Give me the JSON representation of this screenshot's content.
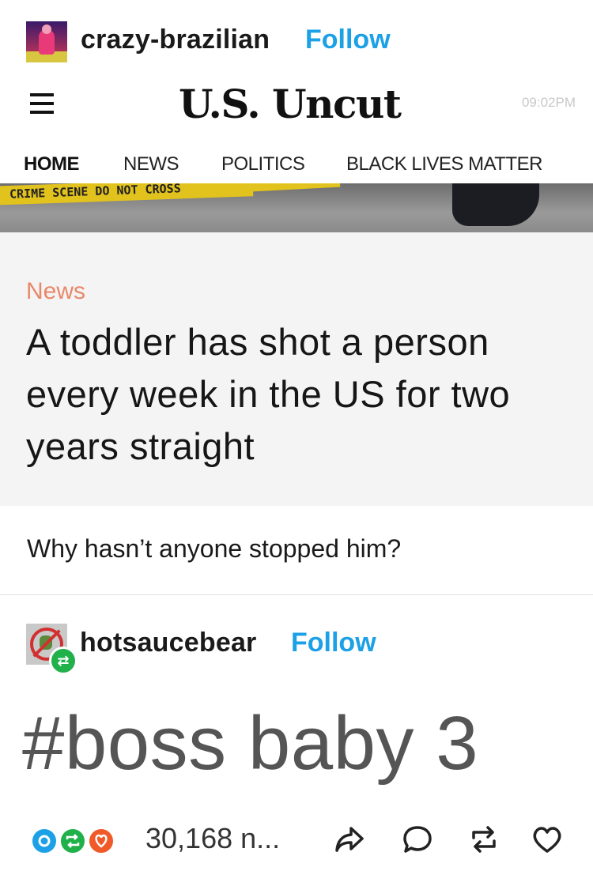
{
  "post": {
    "username": "crazy-brazilian",
    "follow_label": "Follow"
  },
  "article": {
    "site_name": "U.S. Uncut",
    "time": "09:02PM",
    "nav": [
      "HOME",
      "NEWS",
      "POLITICS",
      "BLACK LIVES MATTER"
    ],
    "tape_text": "CRIME SCENE DO NOT CROSS",
    "category": "News",
    "title": "A toddler has shot a person every week in the US for two years straight"
  },
  "caption": "Why hasn’t anyone stopped him?",
  "reblog": {
    "username": "hotsaucebear",
    "follow_label": "Follow"
  },
  "tag": "#boss baby 3",
  "footer": {
    "notes": "30,168 n...",
    "bubble_colors": [
      "#1ca0e6",
      "#20b14a",
      "#f05a28"
    ]
  },
  "colors": {
    "follow": "#1ca0e6",
    "category": "#e8886a",
    "tape": "#e2c21d"
  }
}
